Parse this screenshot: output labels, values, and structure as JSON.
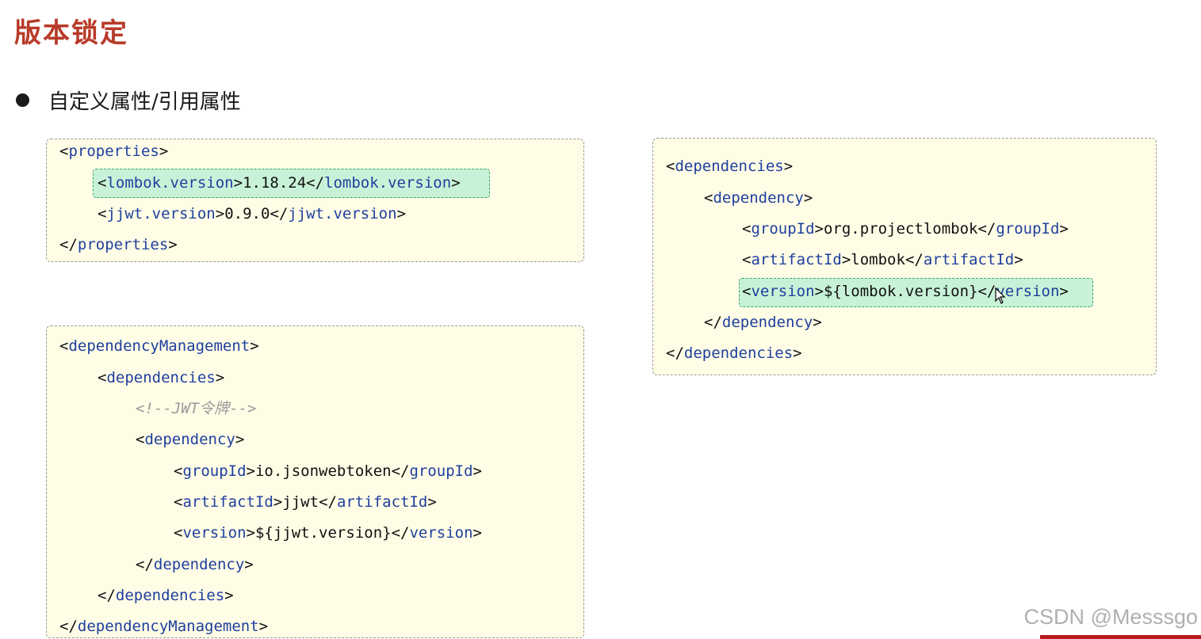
{
  "title": "版本锁定",
  "bullet": "自定义属性/引用属性",
  "box_props": {
    "l1_tag": "properties",
    "l2_tag": "lombok.version",
    "l2_val": "1.18.24",
    "l3_tag": "jjwt.version",
    "l3_val": "0.9.0",
    "l4_tag": "properties"
  },
  "box_mgmt": {
    "l1_tag": "dependencyManagement",
    "l2_tag": "dependencies",
    "l3_comment": "<!--JWT令牌-->",
    "l4_tag": "dependency",
    "l5_tag": "groupId",
    "l5_val": "io.jsonwebtoken",
    "l6_tag": "artifactId",
    "l6_val": "jjwt",
    "l7_tag": "version",
    "l7_val": "${jjwt.version}",
    "l8_tag": "dependency",
    "l9_tag": "dependencies",
    "l10_tag": "dependencyManagement"
  },
  "box_deps": {
    "l1_tag": "dependencies",
    "l2_tag": "dependency",
    "l3_tag": "groupId",
    "l3_val": "org.projectlombok",
    "l4_tag": "artifactId",
    "l4_val": "lombok",
    "l5_tag": "version",
    "l5_val": "${lombok.version}",
    "l6_tag": "dependency",
    "l7_tag": "dependencies"
  },
  "watermark": "CSDN @Messsgo",
  "icons": {
    "bullet": "bullet-dot-icon",
    "cursor": "mouse-cursor-icon"
  },
  "colors": {
    "title": "#b83b2a",
    "tag": "#1f3f9e",
    "box_bg": "#fffde6",
    "highlight_bg": "#c8f2d7",
    "highlight_border": "#3aa86a"
  }
}
